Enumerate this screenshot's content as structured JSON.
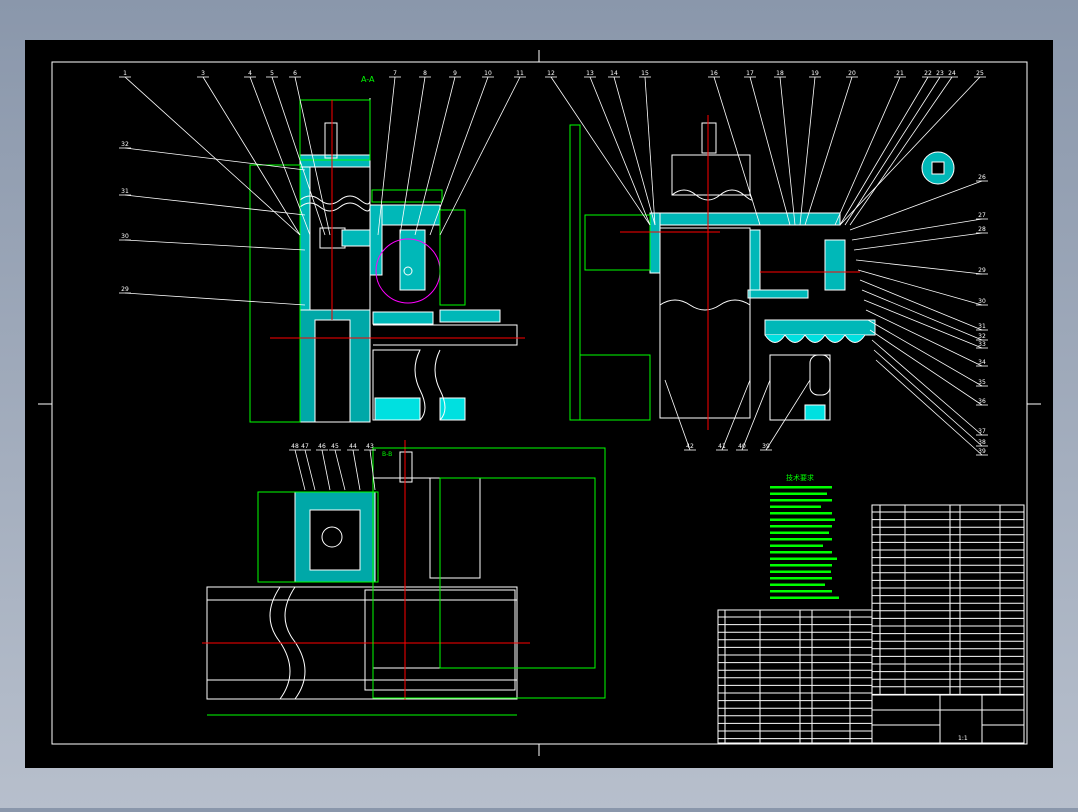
{
  "drawing": {
    "background": "#000000",
    "colors": {
      "outline": "#ffffff",
      "dimension": "#00ff00",
      "section_fill": "#00ffff",
      "centerline": "#ff0000",
      "circle": "#ff00ff"
    },
    "section_labels": {
      "main": "A-A",
      "plan": "B-B"
    },
    "balloons_top": [
      "1",
      "3",
      "4",
      "5",
      "6",
      "7",
      "8",
      "9",
      "10",
      "11",
      "12",
      "13",
      "14",
      "15",
      "16",
      "17",
      "18",
      "19",
      "20",
      "21",
      "22",
      "23",
      "24",
      "25"
    ],
    "balloons_left": [
      "32",
      "31",
      "30",
      "29"
    ],
    "balloons_right": [
      "26",
      "27",
      "28",
      "29",
      "30",
      "31",
      "32",
      "33",
      "34",
      "35",
      "36",
      "37",
      "38",
      "39"
    ],
    "balloons_bottom": [
      "42",
      "41",
      "40",
      "39"
    ],
    "balloons_plan": [
      "48",
      "47",
      "46",
      "45",
      "44",
      "43"
    ]
  },
  "notes": {
    "title": "技术要求",
    "line_count": 18
  },
  "title_block": {
    "scale": "1:1"
  }
}
